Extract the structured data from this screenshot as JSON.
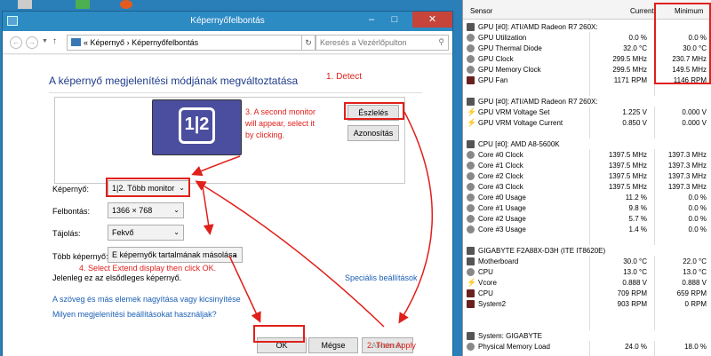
{
  "window": {
    "title": "Képernyőfelbontás"
  },
  "nav": {
    "breadcrumb_sep": "«",
    "crumb1": "Képernyő",
    "crumb_arrow": "›",
    "crumb2": "Képernyőfelbontás",
    "search_placeholder": "Keresés a Vezérlőpulton"
  },
  "page": {
    "heading": "A képernyő megjelenítési módjának megváltoztatása",
    "monitor_label": "1|2",
    "detect_button": "Észlelés",
    "identify_button": "Azonosítás",
    "display_label": "Képernyő:",
    "display_value": "1|2. Több monitor",
    "resolution_label": "Felbontás:",
    "resolution_value": "1366 × 768",
    "orientation_label": "Tájolás:",
    "orientation_value": "Fekvő",
    "multi_label": "Több képernyő:",
    "multi_value": "E képernyők tartalmának másolása",
    "primary_text": "Jelenleg ez az elsődleges képernyő.",
    "advanced_link": "Speciális beállítások",
    "link1": "A szöveg és más elemek nagyítása vagy kicsinyítése",
    "link2": "Milyen megjelenítési beállításokat használjak?",
    "ok_button": "OK",
    "cancel_button": "Mégse",
    "apply_button": "Alkalmaz"
  },
  "annotations": {
    "a1": "1.  Detect",
    "a3_line1": "3. A second monitor",
    "a3_line2": "will appear, select it",
    "a3_line3": "by clicking.",
    "a4": "4. Select Extend display then click OK.",
    "a2": "2. Then Apply"
  },
  "sensors": {
    "header": {
      "sensor": "Sensor",
      "current": "Current",
      "minimum": "Minimum"
    },
    "rows": [
      {
        "type": "grp",
        "icon": "chip",
        "name": "GPU [#0]: ATI/AMD Radeon R7 260X:",
        "cur": "",
        "min": ""
      },
      {
        "type": "row",
        "icon": "gauge",
        "name": "GPU Utilization",
        "cur": "0.0 %",
        "min": "0.0 %"
      },
      {
        "type": "row",
        "icon": "gauge",
        "name": "GPU Thermal Diode",
        "cur": "32.0 °C",
        "min": "30.0 °C"
      },
      {
        "type": "row",
        "icon": "gauge",
        "name": "GPU Clock",
        "cur": "299.5 MHz",
        "min": "230.7 MHz"
      },
      {
        "type": "row",
        "icon": "gauge",
        "name": "GPU Memory Clock",
        "cur": "299.5 MHz",
        "min": "149.5 MHz"
      },
      {
        "type": "row",
        "icon": "fan",
        "name": "GPU Fan",
        "cur": "1171 RPM",
        "min": "1146 RPM"
      },
      {
        "type": "gap"
      },
      {
        "type": "grp",
        "icon": "chip",
        "name": "GPU [#0]: ATI/AMD Radeon R7 260X:",
        "cur": "",
        "min": ""
      },
      {
        "type": "row",
        "icon": "bolt",
        "name": "GPU VRM Voltage Set",
        "cur": "1.225 V",
        "min": "0.000 V"
      },
      {
        "type": "row",
        "icon": "bolt",
        "name": "GPU VRM Voltage Current",
        "cur": "0.850 V",
        "min": "0.000 V"
      },
      {
        "type": "gap"
      },
      {
        "type": "grp",
        "icon": "chip",
        "name": "CPU [#0]: AMD A8-5600K",
        "cur": "",
        "min": ""
      },
      {
        "type": "row",
        "icon": "gauge",
        "name": "Core #0 Clock",
        "cur": "1397.5 MHz",
        "min": "1397.3 MHz"
      },
      {
        "type": "row",
        "icon": "gauge",
        "name": "Core #1 Clock",
        "cur": "1397.5 MHz",
        "min": "1397.3 MHz"
      },
      {
        "type": "row",
        "icon": "gauge",
        "name": "Core #2 Clock",
        "cur": "1397.5 MHz",
        "min": "1397.3 MHz"
      },
      {
        "type": "row",
        "icon": "gauge",
        "name": "Core #3 Clock",
        "cur": "1397.5 MHz",
        "min": "1397.3 MHz"
      },
      {
        "type": "row",
        "icon": "gauge",
        "name": "Core #0 Usage",
        "cur": "11.2 %",
        "min": "0.0 %"
      },
      {
        "type": "row",
        "icon": "gauge",
        "name": "Core #1 Usage",
        "cur": "9.8 %",
        "min": "0.0 %"
      },
      {
        "type": "row",
        "icon": "gauge",
        "name": "Core #2 Usage",
        "cur": "5.7 %",
        "min": "0.0 %"
      },
      {
        "type": "row",
        "icon": "gauge",
        "name": "Core #3 Usage",
        "cur": "1.4 %",
        "min": "0.0 %"
      },
      {
        "type": "gap"
      },
      {
        "type": "grp",
        "icon": "chip",
        "name": "GIGABYTE F2A88X-D3H (ITE IT8620E)",
        "cur": "",
        "min": ""
      },
      {
        "type": "row",
        "icon": "chip",
        "name": "Motherboard",
        "cur": "30.0 °C",
        "min": "22.0 °C"
      },
      {
        "type": "row",
        "icon": "gauge",
        "name": "CPU",
        "cur": "13.0 °C",
        "min": "13.0 °C"
      },
      {
        "type": "row",
        "icon": "bolt",
        "name": "Vcore",
        "cur": "0.888 V",
        "min": "0.888 V"
      },
      {
        "type": "row",
        "icon": "fan",
        "name": "CPU",
        "cur": "709 RPM",
        "min": "659 RPM"
      },
      {
        "type": "row",
        "icon": "fan",
        "name": "System2",
        "cur": "903 RPM",
        "min": "0 RPM"
      },
      {
        "type": "gap"
      },
      {
        "type": "gap"
      },
      {
        "type": "grp",
        "icon": "chip",
        "name": "System: GIGABYTE",
        "cur": "",
        "min": ""
      },
      {
        "type": "row",
        "icon": "gauge",
        "name": "Physical Memory Load",
        "cur": "24.0 %",
        "min": "18.0 %"
      }
    ]
  },
  "colors": {
    "accent_red": "#e0201b",
    "title_blue": "#2d8bc4",
    "link_blue": "#1a5fb4"
  }
}
